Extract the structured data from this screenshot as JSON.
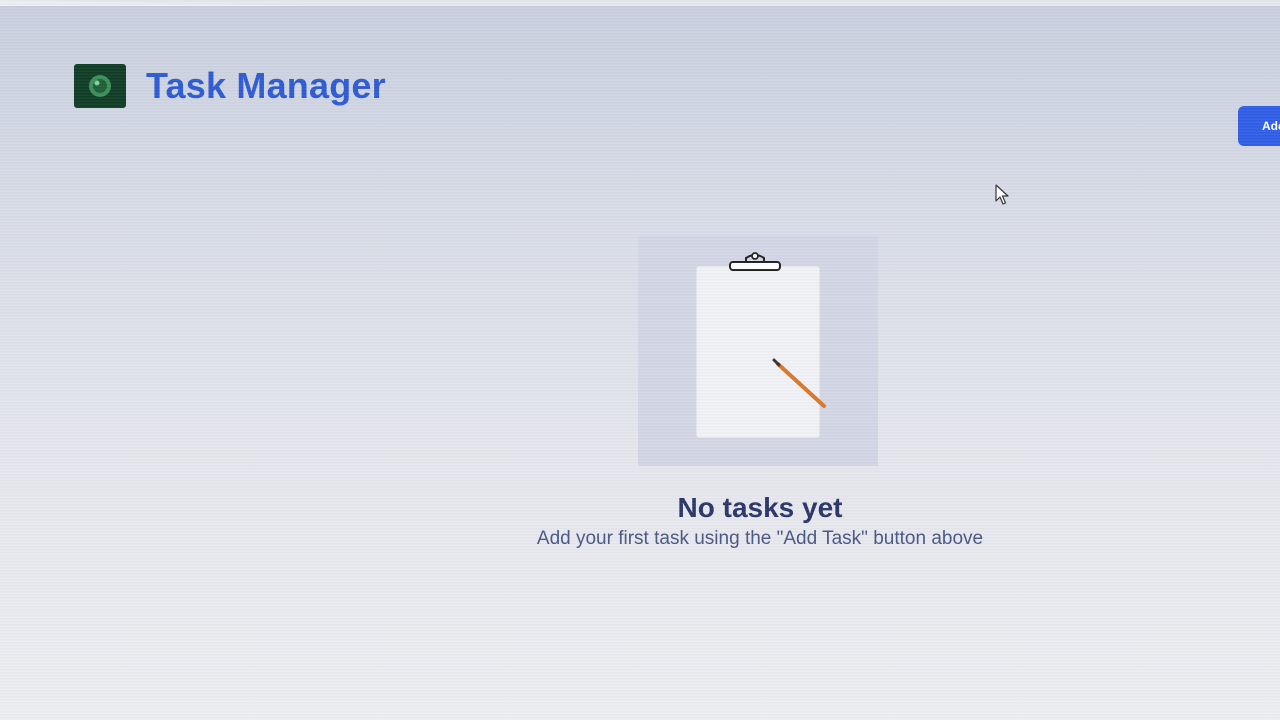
{
  "app": {
    "title": "Task Manager",
    "logo_icon": "app-logo-icon"
  },
  "toolbar": {
    "add_task_label": "Add Task"
  },
  "empty_state": {
    "illustration_icon": "clipboard-pencil-icon",
    "title": "No tasks yet",
    "subtitle": "Add your first task using the \"Add Task\" button above"
  },
  "colors": {
    "brand": "#2d5bd3",
    "button": "#2f5ee6",
    "logo_bg": "#0f3d26",
    "heading": "#2a3668",
    "subtext": "#4a5784"
  }
}
